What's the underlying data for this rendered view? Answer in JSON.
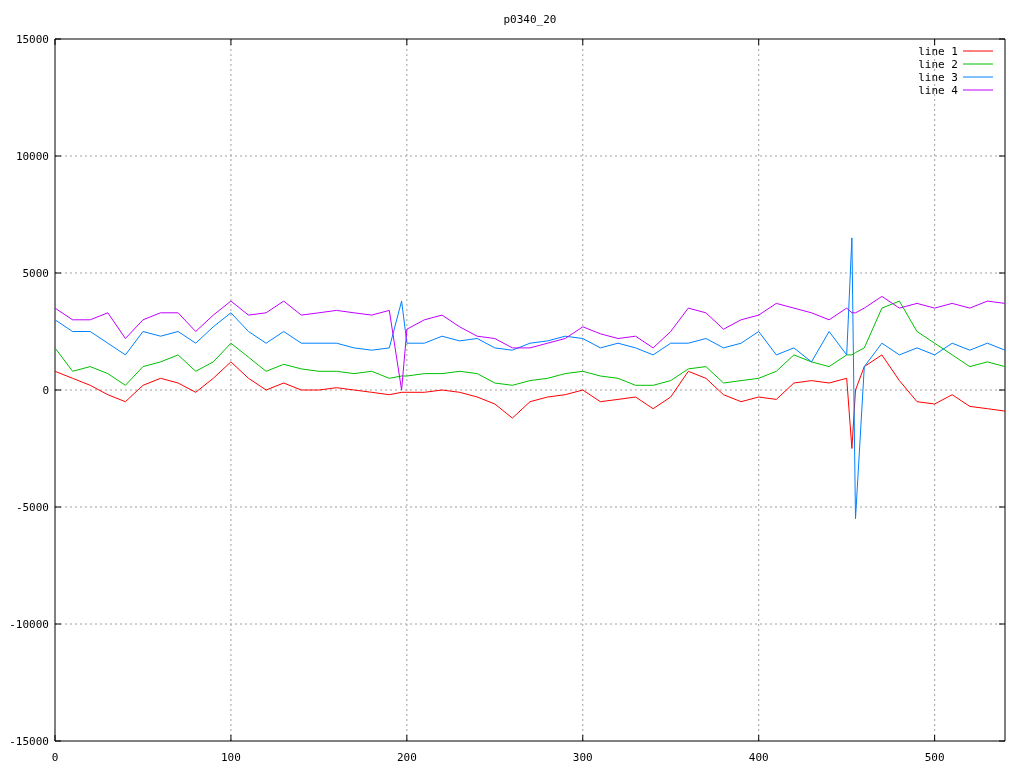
{
  "chart_data": {
    "type": "line",
    "title": "p0340_20",
    "grid": true,
    "legend": true,
    "x": [
      0,
      10,
      20,
      30,
      40,
      50,
      60,
      70,
      80,
      90,
      100,
      110,
      120,
      130,
      140,
      150,
      160,
      170,
      180,
      190,
      197,
      200,
      210,
      220,
      230,
      240,
      250,
      260,
      270,
      280,
      290,
      300,
      310,
      320,
      330,
      340,
      350,
      360,
      370,
      380,
      390,
      400,
      410,
      420,
      430,
      440,
      450,
      453,
      455,
      460,
      470,
      480,
      490,
      500,
      510,
      520,
      530,
      540
    ],
    "xlim": [
      0,
      540
    ],
    "ylim": [
      -15000,
      15000
    ],
    "xticks": [
      0,
      100,
      200,
      300,
      400,
      500
    ],
    "yticks": [
      -15000,
      -10000,
      -5000,
      0,
      5000,
      10000,
      15000
    ],
    "series": [
      {
        "name": "line 1",
        "color": "#ff0000",
        "values": [
          800,
          500,
          200,
          -200,
          -500,
          200,
          500,
          300,
          -100,
          500,
          1200,
          500,
          0,
          300,
          0,
          0,
          100,
          0,
          -100,
          -200,
          -100,
          -100,
          -100,
          0,
          -100,
          -300,
          -600,
          -1200,
          -500,
          -300,
          -200,
          0,
          -500,
          -400,
          -300,
          -800,
          -300,
          800,
          500,
          -200,
          -500,
          -300,
          -400,
          300,
          400,
          300,
          500,
          -2500,
          0,
          1000,
          1500,
          400,
          -500,
          -600,
          -200,
          -700,
          -800,
          -900
        ]
      },
      {
        "name": "line 2",
        "color": "#00c000",
        "values": [
          1800,
          800,
          1000,
          700,
          200,
          1000,
          1200,
          1500,
          800,
          1200,
          2000,
          1400,
          800,
          1100,
          900,
          800,
          800,
          700,
          800,
          500,
          600,
          600,
          700,
          700,
          800,
          700,
          300,
          200,
          400,
          500,
          700,
          800,
          600,
          500,
          200,
          200,
          400,
          900,
          1000,
          300,
          400,
          500,
          800,
          1500,
          1200,
          1000,
          1500,
          1500,
          1600,
          1800,
          3500,
          3800,
          2500,
          2000,
          1500,
          1000,
          1200,
          1000
        ]
      },
      {
        "name": "line 3",
        "color": "#0080ff",
        "values": [
          3000,
          2500,
          2500,
          2000,
          1500,
          2500,
          2300,
          2500,
          2000,
          2700,
          3300,
          2500,
          2000,
          2500,
          2000,
          2000,
          2000,
          1800,
          1700,
          1800,
          3800,
          2000,
          2000,
          2300,
          2100,
          2200,
          1800,
          1700,
          2000,
          2100,
          2300,
          2200,
          1800,
          2000,
          1800,
          1500,
          2000,
          2000,
          2200,
          1800,
          2000,
          2500,
          1500,
          1800,
          1200,
          2500,
          1500,
          6500,
          -5500,
          1000,
          2000,
          1500,
          1800,
          1500,
          2000,
          1700,
          2000,
          1700
        ]
      },
      {
        "name": "line 4",
        "color": "#c000ff",
        "values": [
          3500,
          3000,
          3000,
          3300,
          2200,
          3000,
          3300,
          3300,
          2500,
          3200,
          3800,
          3200,
          3300,
          3800,
          3200,
          3300,
          3400,
          3300,
          3200,
          3400,
          0,
          2600,
          3000,
          3200,
          2700,
          2300,
          2200,
          1800,
          1800,
          2000,
          2200,
          2700,
          2400,
          2200,
          2300,
          1800,
          2500,
          3500,
          3300,
          2600,
          3000,
          3200,
          3700,
          3500,
          3300,
          3000,
          3500,
          3300,
          3300,
          3500,
          4000,
          3500,
          3700,
          3500,
          3700,
          3500,
          3800,
          3700
        ]
      }
    ]
  }
}
